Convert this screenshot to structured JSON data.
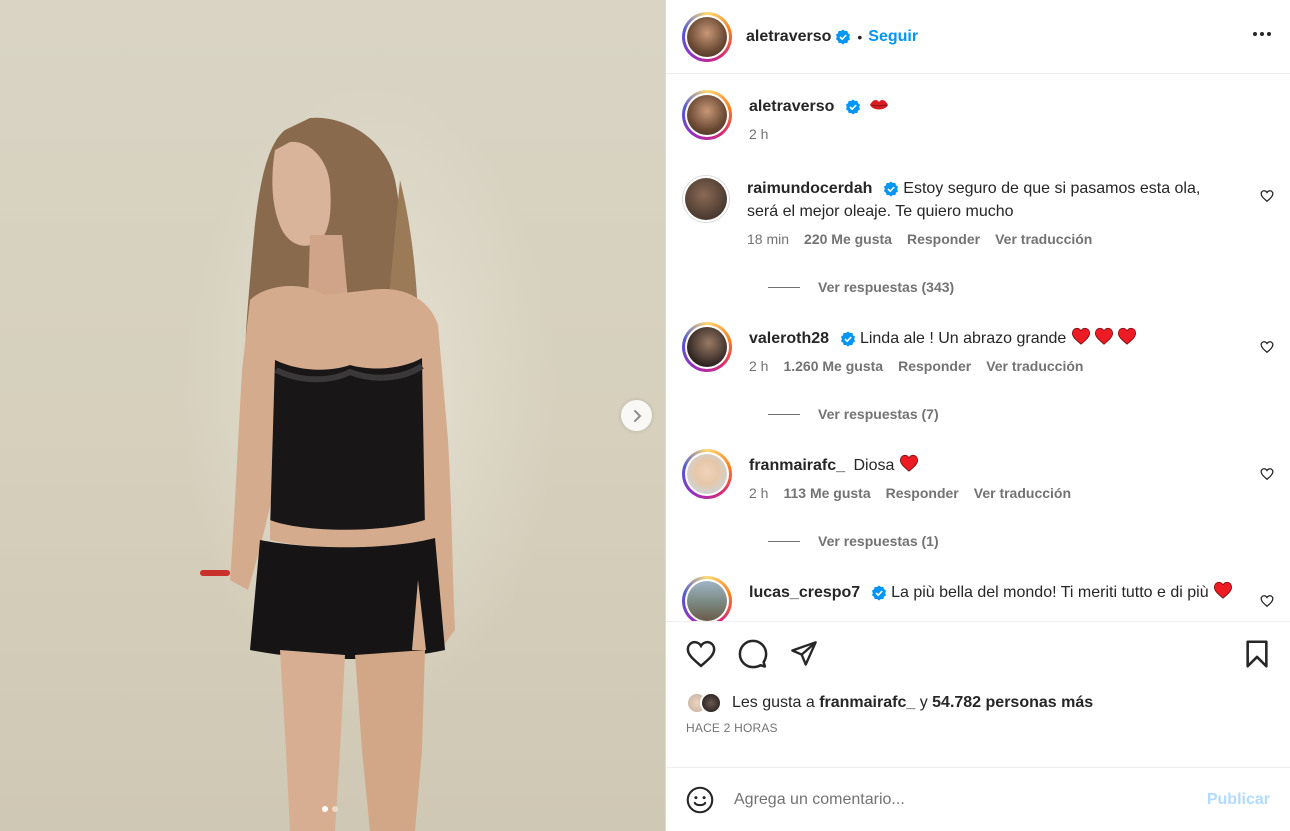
{
  "post": {
    "slide_count": 2,
    "active_slide": 1
  },
  "header": {
    "username": "aletraverso",
    "separator": "•",
    "follow_label": "Seguir",
    "more_icon": "more-horizontal-icon"
  },
  "caption": {
    "username": "aletraverso",
    "emoji": "lips-emoji",
    "time": "2 h"
  },
  "comments": [
    {
      "username": "raimundocerdah",
      "verified": true,
      "text": "Estoy seguro de que si pasamos esta ola, será el mejor oleaje. Te quiero mucho",
      "time": "18 min",
      "likes": "220 Me gusta",
      "reply_label": "Responder",
      "translate_label": "Ver traducción",
      "replies_label": "Ver respuestas (343)"
    },
    {
      "username": "valeroth28",
      "verified": true,
      "text": "Linda ale ! Un abrazo grande",
      "hearts": 3,
      "time": "2 h",
      "likes": "1.260 Me gusta",
      "reply_label": "Responder",
      "translate_label": "Ver traducción",
      "replies_label": "Ver respuestas (7)"
    },
    {
      "username": "franmairafc_",
      "verified": false,
      "text": "Diosa",
      "hearts": 1,
      "time": "2 h",
      "likes": "113 Me gusta",
      "reply_label": "Responder",
      "translate_label": "Ver traducción",
      "replies_label": "Ver respuestas (1)"
    },
    {
      "username": "lucas_crespo7",
      "verified": true,
      "text": "La più bella del mondo! Ti meriti tutto e di più",
      "hearts": 1
    }
  ],
  "likes": {
    "prefix": "Les gusta a",
    "user": "franmairafc_",
    "connector": "y",
    "count_text": "54.782 personas más"
  },
  "timestamp": "HACE 2 HORAS",
  "composer": {
    "placeholder": "Agrega un comentario...",
    "publish_label": "Publicar"
  },
  "colors": {
    "link": "#0095f6",
    "verified": "#0095f6",
    "publish_disabled": "#b3dbff",
    "heart_red": "#ed1c24"
  }
}
